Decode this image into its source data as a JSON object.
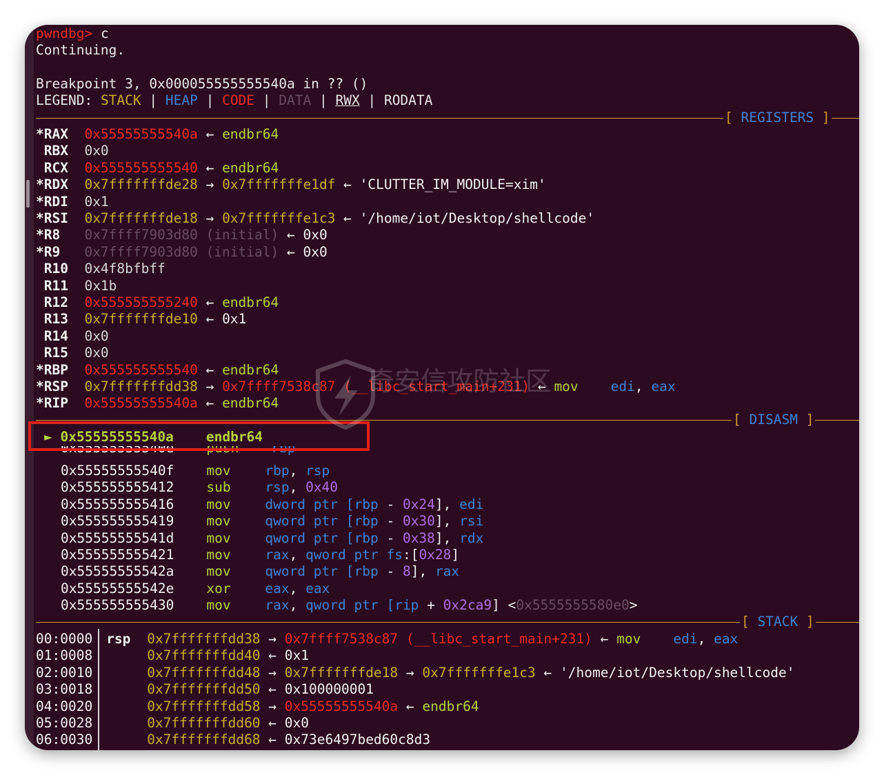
{
  "prompt": "pwndbg>",
  "command": "c",
  "continuing": "Continuing.",
  "breakpoint": "Breakpoint 3, 0x000055555555540a in ?? ()",
  "legend": {
    "label": "LEGEND:",
    "stack": "STACK",
    "heap": "HEAP",
    "code": "CODE",
    "data": "DATA",
    "rwx": "RWX",
    "rodata": "RODATA"
  },
  "sections": {
    "registers": "REGISTERS",
    "disasm": "DISASM",
    "stack": "STACK"
  },
  "registers": [
    {
      "name": "*RAX",
      "value": "0x55555555540a",
      "value_color": "red",
      "rest": [
        {
          "t": " ← ",
          "c": "wht"
        },
        {
          "t": "endbr64",
          "c": "grn"
        }
      ]
    },
    {
      "name": " RBX",
      "value": "0x0",
      "value_color": "gry",
      "rest": []
    },
    {
      "name": " RCX",
      "value": "0x555555555540",
      "value_color": "red",
      "rest": [
        {
          "t": " ← ",
          "c": "wht"
        },
        {
          "t": "endbr64",
          "c": "grn"
        }
      ]
    },
    {
      "name": "*RDX",
      "value": "0x7fffffffde28",
      "value_color": "yel",
      "rest": [
        {
          "t": " → ",
          "c": "wht"
        },
        {
          "t": "0x7fffffffe1df",
          "c": "yel"
        },
        {
          "t": " ← ",
          "c": "wht"
        },
        {
          "t": "'CLUTTER_IM_MODULE=xim'",
          "c": "wht"
        }
      ]
    },
    {
      "name": "*RDI",
      "value": "0x1",
      "value_color": "gry",
      "rest": []
    },
    {
      "name": "*RSI",
      "value": "0x7fffffffde18",
      "value_color": "yel",
      "rest": [
        {
          "t": " → ",
          "c": "wht"
        },
        {
          "t": "0x7fffffffe1c3",
          "c": "yel"
        },
        {
          "t": " ← ",
          "c": "wht"
        },
        {
          "t": "'/home/iot/Desktop/shellcode'",
          "c": "wht"
        }
      ]
    },
    {
      "name": "*R8 ",
      "value": "0x7ffff7903d80",
      "value_color": "dim",
      "rest": [
        {
          "t": " (initial)",
          "c": "dim"
        },
        {
          "t": " ← ",
          "c": "wht"
        },
        {
          "t": "0x0",
          "c": "wht"
        }
      ]
    },
    {
      "name": "*R9 ",
      "value": "0x7ffff7903d80",
      "value_color": "dim",
      "rest": [
        {
          "t": " (initial)",
          "c": "dim"
        },
        {
          "t": " ← ",
          "c": "wht"
        },
        {
          "t": "0x0",
          "c": "wht"
        }
      ]
    },
    {
      "name": " R10",
      "value": "0x4f8bfbff",
      "value_color": "gry",
      "rest": []
    },
    {
      "name": " R11",
      "value": "0x1b",
      "value_color": "gry",
      "rest": []
    },
    {
      "name": " R12",
      "value": "0x555555555240",
      "value_color": "red",
      "rest": [
        {
          "t": " ← ",
          "c": "wht"
        },
        {
          "t": "endbr64",
          "c": "grn"
        }
      ]
    },
    {
      "name": " R13",
      "value": "0x7fffffffde10",
      "value_color": "yel",
      "rest": [
        {
          "t": " ← ",
          "c": "wht"
        },
        {
          "t": "0x1",
          "c": "wht"
        }
      ]
    },
    {
      "name": " R14",
      "value": "0x0",
      "value_color": "gry",
      "rest": []
    },
    {
      "name": " R15",
      "value": "0x0",
      "value_color": "gry",
      "rest": []
    },
    {
      "name": "*RBP",
      "value": "0x555555555540",
      "value_color": "red",
      "rest": [
        {
          "t": " ← ",
          "c": "wht"
        },
        {
          "t": "endbr64",
          "c": "grn"
        }
      ]
    },
    {
      "name": "*RSP",
      "value": "0x7fffffffdd38",
      "value_color": "yel",
      "rest": [
        {
          "t": " → ",
          "c": "wht"
        },
        {
          "t": "0x7ffff7538c87",
          "c": "red"
        },
        {
          "t": " (__libc_start_main+231)",
          "c": "red"
        },
        {
          "t": " ← ",
          "c": "wht"
        },
        {
          "t": "mov    ",
          "c": "grn"
        },
        {
          "t": "edi",
          "c": "blu"
        },
        {
          "t": ", ",
          "c": "wht"
        },
        {
          "t": "eax",
          "c": "blu"
        }
      ]
    },
    {
      "name": "*RIP",
      "value": "0x55555555540a",
      "value_color": "red",
      "rest": [
        {
          "t": " ← ",
          "c": "wht"
        },
        {
          "t": "endbr64",
          "c": "grn"
        }
      ]
    }
  ],
  "disasm_current": {
    "marker": "►",
    "addr": "0x55555555540a",
    "mnemonic": "endbr64"
  },
  "disasm_partial": {
    "addr": "0x55555555540e",
    "mnemonic": "push",
    "operands": "rbp"
  },
  "disasm": [
    {
      "addr": "0x55555555540f",
      "mnemonic": "mov",
      "ops": [
        {
          "t": "rbp",
          "c": "blu"
        },
        {
          "t": ", ",
          "c": "wht"
        },
        {
          "t": "rsp",
          "c": "blu"
        }
      ]
    },
    {
      "addr": "0x555555555412",
      "mnemonic": "sub",
      "ops": [
        {
          "t": "rsp",
          "c": "blu"
        },
        {
          "t": ", ",
          "c": "wht"
        },
        {
          "t": "0x40",
          "c": "pur"
        }
      ]
    },
    {
      "addr": "0x555555555416",
      "mnemonic": "mov",
      "ops": [
        {
          "t": "dword ptr [",
          "c": "blu"
        },
        {
          "t": "rbp",
          "c": "blu"
        },
        {
          "t": " - ",
          "c": "wht"
        },
        {
          "t": "0x24",
          "c": "pur"
        },
        {
          "t": "], ",
          "c": "wht"
        },
        {
          "t": "edi",
          "c": "blu"
        }
      ]
    },
    {
      "addr": "0x555555555419",
      "mnemonic": "mov",
      "ops": [
        {
          "t": "qword ptr [",
          "c": "blu"
        },
        {
          "t": "rbp",
          "c": "blu"
        },
        {
          "t": " - ",
          "c": "wht"
        },
        {
          "t": "0x30",
          "c": "pur"
        },
        {
          "t": "], ",
          "c": "wht"
        },
        {
          "t": "rsi",
          "c": "blu"
        }
      ]
    },
    {
      "addr": "0x55555555541d",
      "mnemonic": "mov",
      "ops": [
        {
          "t": "qword ptr [",
          "c": "blu"
        },
        {
          "t": "rbp",
          "c": "blu"
        },
        {
          "t": " - ",
          "c": "wht"
        },
        {
          "t": "0x38",
          "c": "pur"
        },
        {
          "t": "], ",
          "c": "wht"
        },
        {
          "t": "rdx",
          "c": "blu"
        }
      ]
    },
    {
      "addr": "0x555555555421",
      "mnemonic": "mov",
      "ops": [
        {
          "t": "rax",
          "c": "blu"
        },
        {
          "t": ", ",
          "c": "wht"
        },
        {
          "t": "qword ptr ",
          "c": "blu"
        },
        {
          "t": "fs",
          "c": "blu"
        },
        {
          "t": ":[",
          "c": "wht"
        },
        {
          "t": "0x28",
          "c": "pur"
        },
        {
          "t": "]",
          "c": "wht"
        }
      ]
    },
    {
      "addr": "0x55555555542a",
      "mnemonic": "mov",
      "ops": [
        {
          "t": "qword ptr [",
          "c": "blu"
        },
        {
          "t": "rbp",
          "c": "blu"
        },
        {
          "t": " - ",
          "c": "wht"
        },
        {
          "t": "8",
          "c": "pur"
        },
        {
          "t": "], ",
          "c": "wht"
        },
        {
          "t": "rax",
          "c": "blu"
        }
      ]
    },
    {
      "addr": "0x55555555542e",
      "mnemonic": "xor",
      "ops": [
        {
          "t": "eax",
          "c": "blu"
        },
        {
          "t": ", ",
          "c": "wht"
        },
        {
          "t": "eax",
          "c": "blu"
        }
      ]
    },
    {
      "addr": "0x555555555430",
      "mnemonic": "mov",
      "ops": [
        {
          "t": "rax",
          "c": "blu"
        },
        {
          "t": ", ",
          "c": "wht"
        },
        {
          "t": "qword ptr [",
          "c": "blu"
        },
        {
          "t": "rip",
          "c": "blu"
        },
        {
          "t": " + ",
          "c": "wht"
        },
        {
          "t": "0x2ca9",
          "c": "pur"
        },
        {
          "t": "] <",
          "c": "wht"
        },
        {
          "t": "0x5555555580e0",
          "c": "dim"
        },
        {
          "t": ">",
          "c": "wht"
        }
      ]
    }
  ],
  "stack": [
    {
      "off": "00:0000",
      "reg": "rsp",
      "addr": "0x7fffffffdd38",
      "rest": [
        {
          "t": " → ",
          "c": "wht"
        },
        {
          "t": "0x7ffff7538c87 (__libc_start_main+231)",
          "c": "red"
        },
        {
          "t": " ← ",
          "c": "wht"
        },
        {
          "t": "mov    ",
          "c": "grn"
        },
        {
          "t": "edi",
          "c": "blu"
        },
        {
          "t": ", ",
          "c": "wht"
        },
        {
          "t": "eax",
          "c": "blu"
        }
      ]
    },
    {
      "off": "01:0008",
      "reg": "",
      "addr": "0x7fffffffdd40",
      "rest": [
        {
          "t": " ← ",
          "c": "wht"
        },
        {
          "t": "0x1",
          "c": "wht"
        }
      ]
    },
    {
      "off": "02:0010",
      "reg": "",
      "addr": "0x7fffffffdd48",
      "rest": [
        {
          "t": " → ",
          "c": "wht"
        },
        {
          "t": "0x7fffffffde18",
          "c": "yel"
        },
        {
          "t": " → ",
          "c": "wht"
        },
        {
          "t": "0x7fffffffe1c3",
          "c": "yel"
        },
        {
          "t": " ← ",
          "c": "wht"
        },
        {
          "t": "'/home/iot/Desktop/shellcode'",
          "c": "wht"
        }
      ]
    },
    {
      "off": "03:0018",
      "reg": "",
      "addr": "0x7fffffffdd50",
      "rest": [
        {
          "t": " ← ",
          "c": "wht"
        },
        {
          "t": "0x100000001",
          "c": "wht"
        }
      ]
    },
    {
      "off": "04:0020",
      "reg": "",
      "addr": "0x7fffffffdd58",
      "rest": [
        {
          "t": " → ",
          "c": "wht"
        },
        {
          "t": "0x55555555540a",
          "c": "red"
        },
        {
          "t": " ← ",
          "c": "wht"
        },
        {
          "t": "endbr64",
          "c": "grn"
        }
      ]
    },
    {
      "off": "05:0028",
      "reg": "",
      "addr": "0x7fffffffdd60",
      "rest": [
        {
          "t": " ← ",
          "c": "wht"
        },
        {
          "t": "0x0",
          "c": "wht"
        }
      ]
    },
    {
      "off": "06:0030",
      "reg": "",
      "addr": "0x7fffffffdd68",
      "rest": [
        {
          "t": " ← ",
          "c": "wht"
        },
        {
          "t": "0x73e6497bed60c8d3",
          "c": "wht"
        }
      ]
    }
  ],
  "watermark": "奇安信攻防社区",
  "colors": {
    "background": "#2c0a20",
    "red": "#ea2e25",
    "yellow": "#c9ad2c",
    "green": "#b7d43d",
    "blue": "#3f82d1",
    "purple": "#b06ee0",
    "highlight_box": "#e0211b",
    "separator": "#d39b2a"
  }
}
